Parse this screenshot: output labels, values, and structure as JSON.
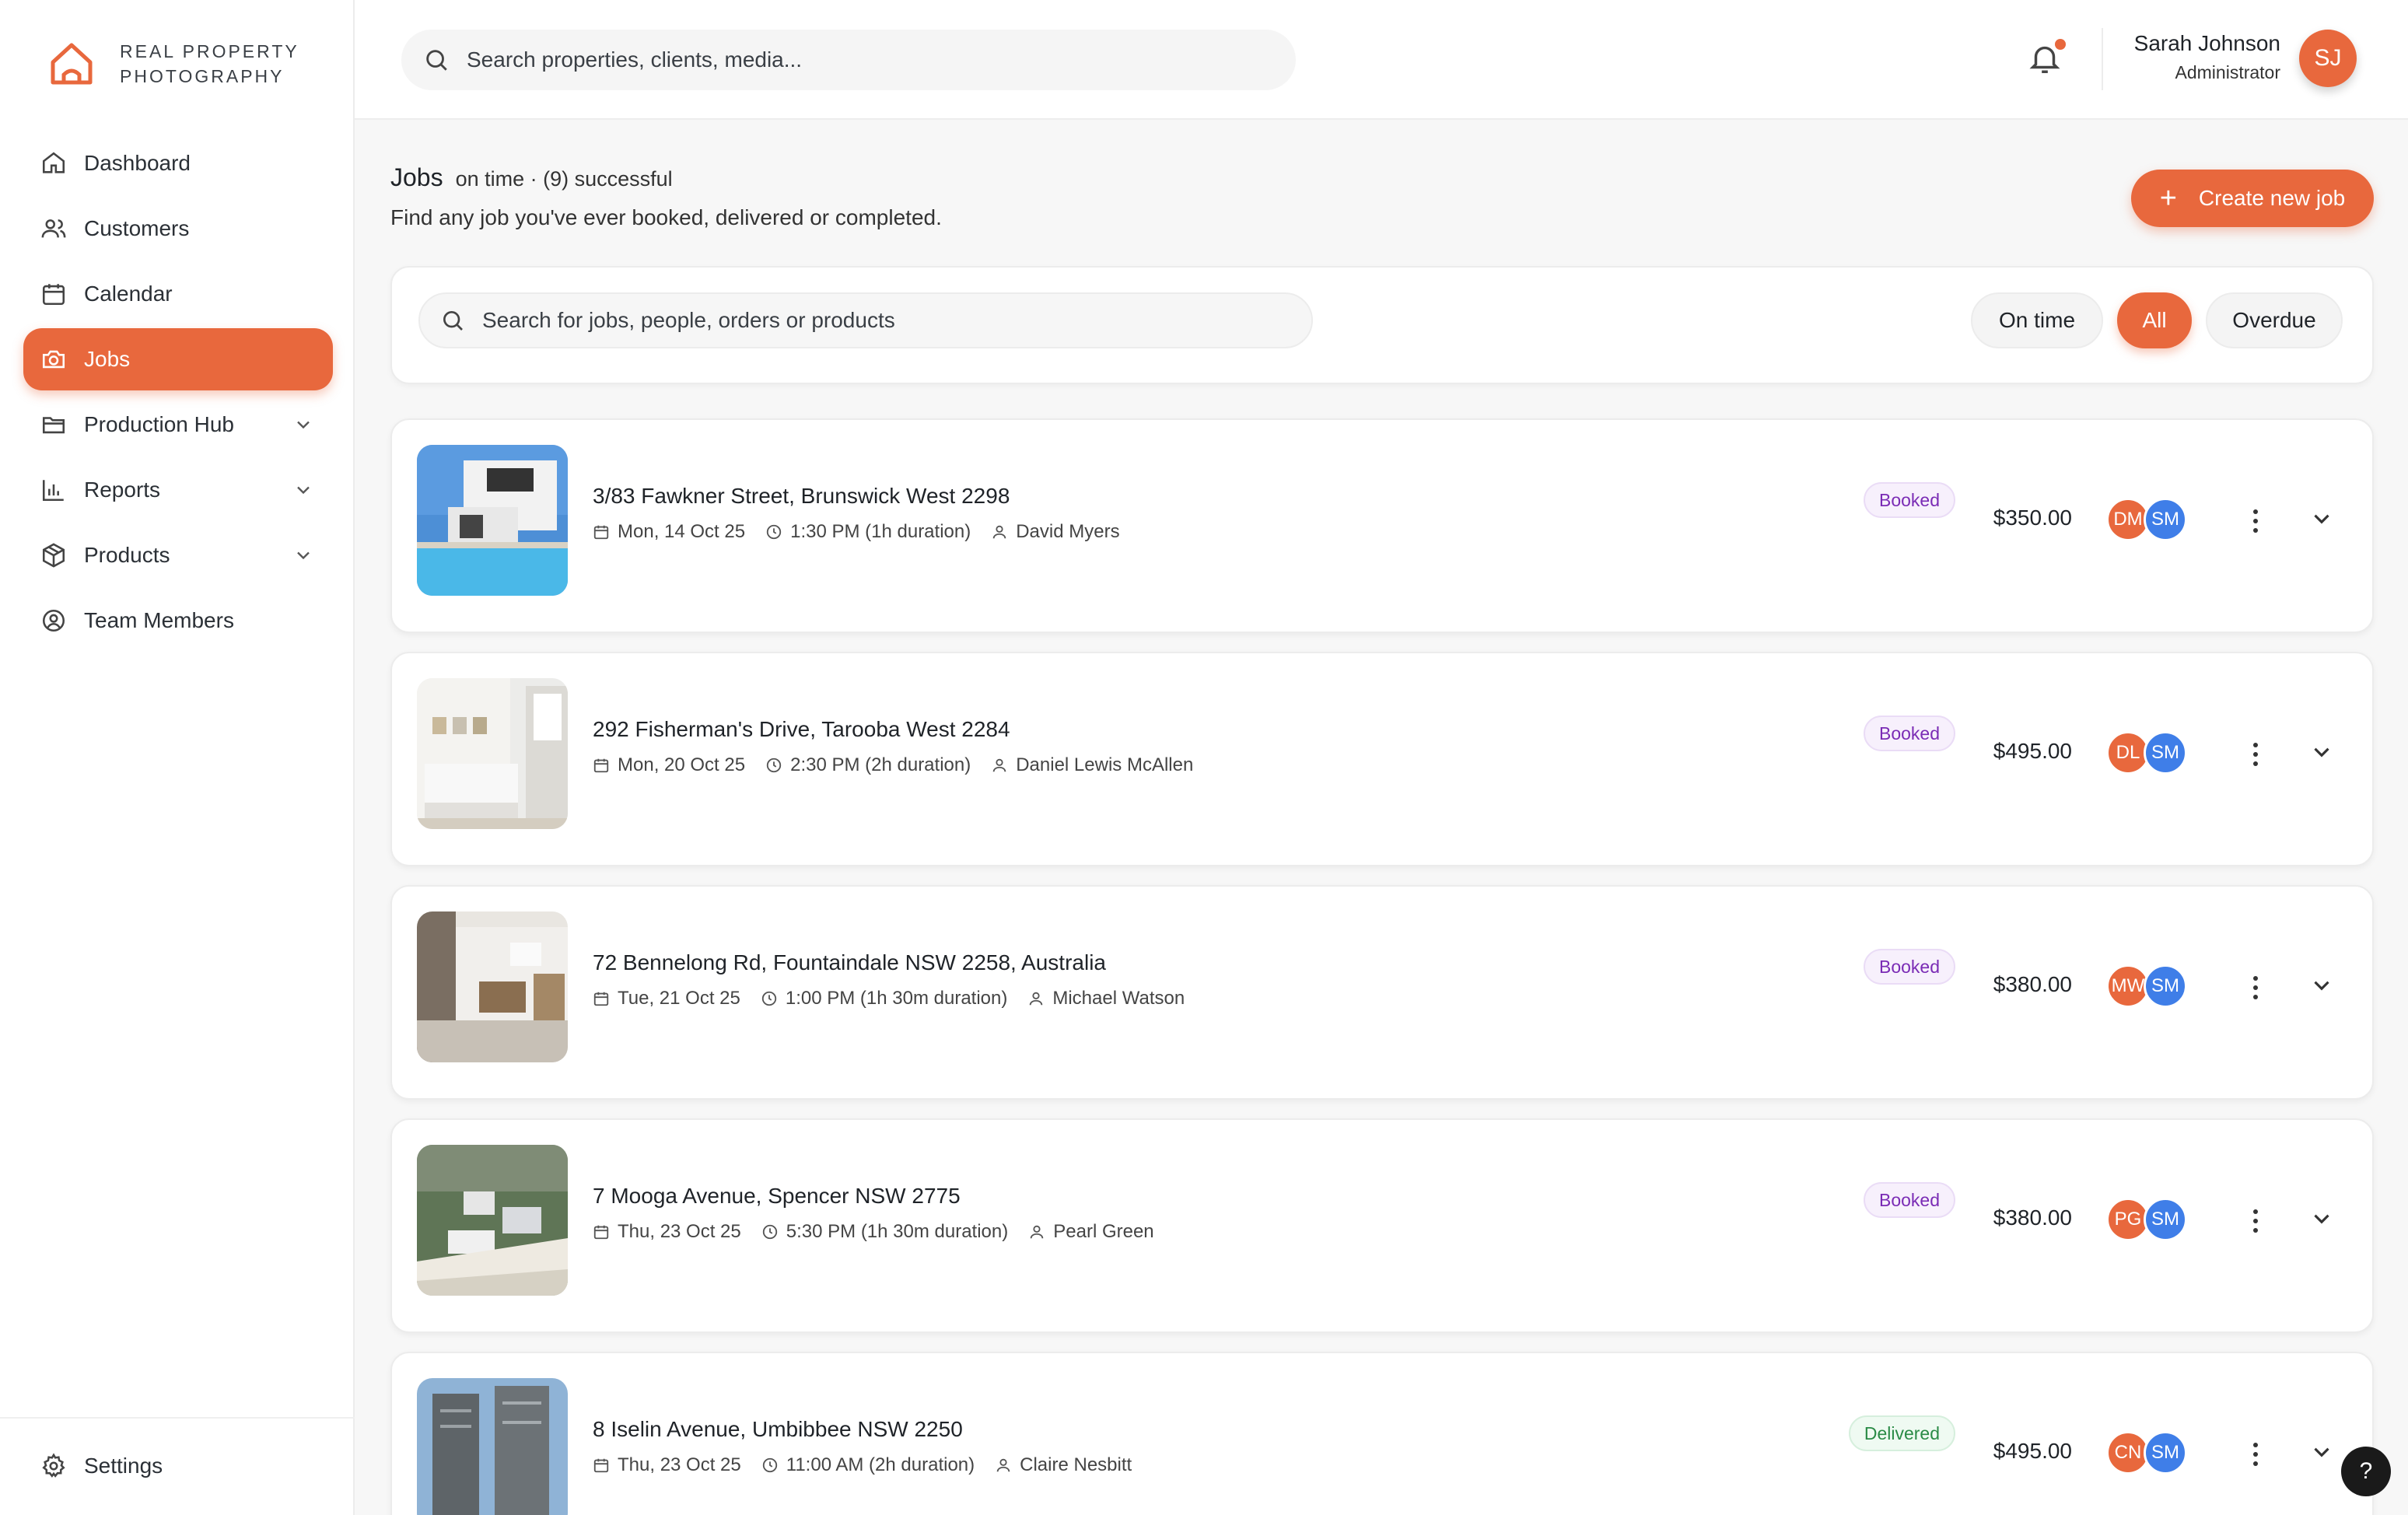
{
  "brand": {
    "line1": "REAL PROPERTY",
    "line2": "PHOTOGRAPHY",
    "accent": "#e8683d"
  },
  "sidebar": {
    "items": [
      {
        "label": "Dashboard",
        "icon": "home-icon"
      },
      {
        "label": "Customers",
        "icon": "users-icon"
      },
      {
        "label": "Calendar",
        "icon": "calendar-icon"
      },
      {
        "label": "Jobs",
        "icon": "camera-icon",
        "active": true
      },
      {
        "label": "Production Hub",
        "icon": "folder-icon",
        "expandable": true
      },
      {
        "label": "Reports",
        "icon": "bar-chart-icon",
        "expandable": true
      },
      {
        "label": "Products",
        "icon": "package-icon",
        "expandable": true
      },
      {
        "label": "Team Members",
        "icon": "user-circle-icon"
      }
    ],
    "settings_label": "Settings"
  },
  "topbar": {
    "search_placeholder": "Search properties, clients, media...",
    "user_name": "Sarah Johnson",
    "user_role": "Administrator",
    "user_initials": "SJ"
  },
  "page": {
    "title": "Jobs",
    "title_meta": "on time · (9) successful",
    "subtitle": "Find any job you've ever booked, delivered or completed.",
    "create_label": "Create new job"
  },
  "filters": {
    "search_placeholder": "Search for jobs, people, orders or products",
    "options": [
      "On time",
      "All",
      "Overdue"
    ],
    "selected": "All"
  },
  "jobs": [
    {
      "address": "3/83 Fawkner Street, Brunswick West 2298",
      "date": "Mon, 14 Oct 25",
      "time": "1:30 PM (1h duration)",
      "client": "David Myers",
      "status": "Booked",
      "price": "$350.00",
      "avatar1": "DM",
      "avatar2": "SM"
    },
    {
      "address": "292 Fisherman's Drive, Tarooba West 2284",
      "date": "Mon, 20 Oct 25",
      "time": "2:30 PM (2h duration)",
      "client": "Daniel Lewis McAllen",
      "status": "Booked",
      "price": "$495.00",
      "avatar1": "DL",
      "avatar2": "SM"
    },
    {
      "address": "72 Bennelong Rd, Fountaindale NSW 2258, Australia",
      "date": "Tue, 21 Oct 25",
      "time": "1:00 PM (1h 30m duration)",
      "client": "Michael Watson",
      "status": "Booked",
      "price": "$380.00",
      "avatar1": "MW",
      "avatar2": "SM"
    },
    {
      "address": "7 Mooga Avenue, Spencer NSW 2775",
      "date": "Thu, 23 Oct 25",
      "time": "5:30 PM (1h 30m duration)",
      "client": "Pearl Green",
      "status": "Booked",
      "price": "$380.00",
      "avatar1": "PG",
      "avatar2": "SM"
    },
    {
      "address": "8 Iselin Avenue, Umbibbee NSW 2250",
      "date": "Thu, 23 Oct 25",
      "time": "11:00 AM (2h duration)",
      "client": "Claire Nesbitt",
      "status": "Delivered",
      "price": "$495.00",
      "avatar1": "CN",
      "avatar2": "SM"
    }
  ],
  "help_label": "?"
}
